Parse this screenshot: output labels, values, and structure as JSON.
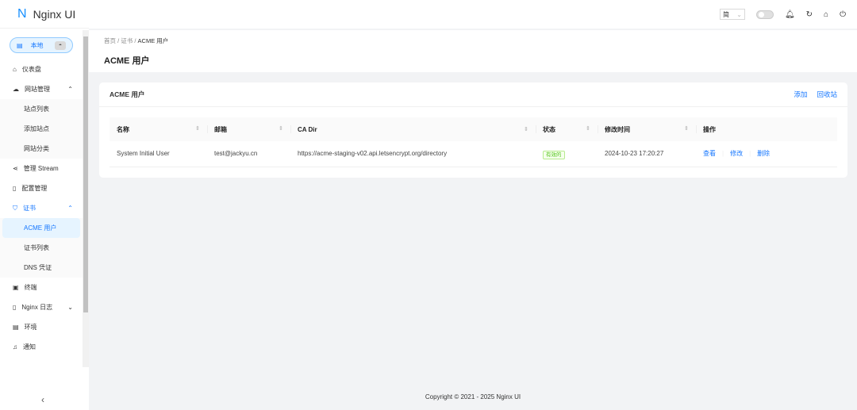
{
  "app": {
    "logo_letter": "N",
    "title": "Nginx UI"
  },
  "sidebar": {
    "env_label": "本地",
    "items": [
      {
        "label": "仪表盘",
        "icon": "home-icon"
      },
      {
        "label": "网站管理",
        "icon": "cloud-icon",
        "children": [
          "站点列表",
          "添加站点",
          "网站分类"
        ]
      },
      {
        "label": "管理 Stream",
        "icon": "share-icon"
      },
      {
        "label": "配置管理",
        "icon": "file-icon"
      },
      {
        "label": "证书",
        "icon": "shield-icon",
        "children": [
          "ACME 用户",
          "证书列表",
          "DNS 凭证"
        ]
      },
      {
        "label": "终端",
        "icon": "terminal-icon"
      },
      {
        "label": "Nginx 日志",
        "icon": "log-icon"
      },
      {
        "label": "环境",
        "icon": "database-icon"
      },
      {
        "label": "通知",
        "icon": "bell-icon"
      }
    ]
  },
  "header": {
    "lang": "简"
  },
  "breadcrumb": [
    "首页",
    "证书",
    "ACME 用户"
  ],
  "page_title": "ACME 用户",
  "card": {
    "title": "ACME 用户",
    "add": "添加",
    "trash": "回收站"
  },
  "table": {
    "headers": [
      "名称",
      "邮箱",
      "CA Dir",
      "状态",
      "修改时间",
      "操作"
    ],
    "rows": [
      {
        "name": "System Initial User",
        "email": "test@jackyu.cn",
        "ca_dir": "https://acme-staging-v02.api.letsencrypt.org/directory",
        "status": "有效的",
        "modified": "2024-10-23 17:20:27",
        "actions": [
          "查看",
          "修改",
          "删除"
        ]
      }
    ]
  },
  "footer": "Copyright © 2021 - 2025 Nginx UI"
}
